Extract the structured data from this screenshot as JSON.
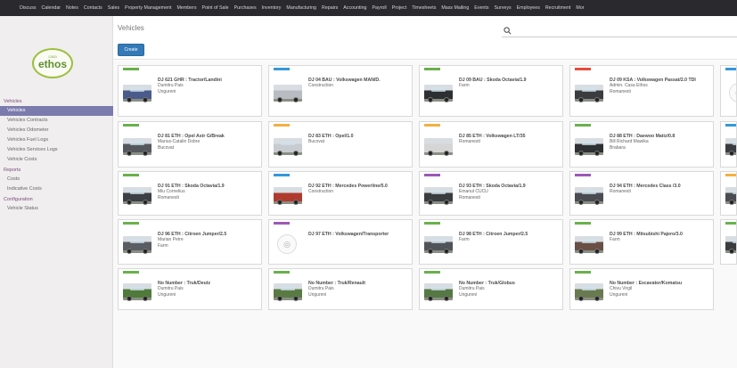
{
  "top_menu": [
    "Discuss",
    "Calendar",
    "Notes",
    "Contacts",
    "Sales",
    "Property Management",
    "Members",
    "Point of Sale",
    "Purchases",
    "Inventory",
    "Manufacturing",
    "Repairs",
    "Accounting",
    "Payroll",
    "Project",
    "Timesheets",
    "Mass Mailing",
    "Events",
    "Surveys",
    "Employees",
    "Recruitment",
    "Mor"
  ],
  "logo": {
    "small": "casa",
    "big": "ethos"
  },
  "sidebar": {
    "sections": [
      {
        "heading": "Vehicles",
        "items": [
          {
            "label": "Vehicles",
            "active": true
          },
          {
            "label": "Vehicles Contracts",
            "active": false
          },
          {
            "label": "Vehicles Odometer",
            "active": false
          },
          {
            "label": "Vehicles Fuel Logs",
            "active": false
          },
          {
            "label": "Vehicles Services Logs",
            "active": false
          },
          {
            "label": "Vehicle Costs",
            "active": false
          }
        ]
      },
      {
        "heading": "Reports",
        "items": [
          {
            "label": "Costs",
            "active": false
          },
          {
            "label": "Indicative Costs",
            "active": false
          }
        ]
      },
      {
        "heading": "Configuration",
        "items": [
          {
            "label": "Vehicle Status",
            "active": false
          }
        ]
      }
    ]
  },
  "header": {
    "breadcrumb": "Vehicles",
    "create_label": "Create",
    "search_placeholder": ""
  },
  "colors": {
    "accent": "#7c7bad",
    "button": "#337ab7"
  },
  "cards": [
    {
      "title": "DJ 621 GHR : Tractor/Landini",
      "lines": [
        "Dumitru Pais",
        "Ungureni"
      ],
      "tag": "#6ab04c",
      "photo": "tractor",
      "body": "#4a5a8a"
    },
    {
      "title": "DJ 04 BAU : Volkswagen MAN/D.",
      "lines": [
        "Construction"
      ],
      "tag": "#3498db",
      "photo": "truck",
      "body": "#b8bcc2"
    },
    {
      "title": "DJ 09 BAU : Skoda Octavia/1.9",
      "lines": [
        "Farm"
      ],
      "tag": "#6ab04c",
      "photo": "car",
      "body": "#2d2f33"
    },
    {
      "title": "DJ 09 KSA : Volkswagen Passat/2.0 TDI",
      "lines": [
        "Admin. Casa Ethos",
        "Romanesti"
      ],
      "tag": "#e74c3c",
      "photo": "car",
      "body": "#3a3c40"
    },
    {
      "title": "DJ 81 ETH : Opel Astr G/Break",
      "lines": [
        "Marius-Catalin Dobre",
        "Bucovat"
      ],
      "tag": "#6ab04c",
      "photo": "car",
      "body": "#55585e"
    },
    {
      "title": "DJ 83 ETH : Opel/1.0",
      "lines": [
        "Bucovat"
      ],
      "tag": "#f5b041",
      "photo": "car",
      "body": "#c8cbd0"
    },
    {
      "title": "DJ 85 ETH : Volkswagen LT/35",
      "lines": [
        "Romanesti"
      ],
      "tag": "#f5b041",
      "photo": "truck",
      "body": "#d5d5d5"
    },
    {
      "title": "DJ 88 ETH : Daewoo Matiz/0.8",
      "lines": [
        "Bill Richard Mawika",
        "Brabara"
      ],
      "tag": "#6ab04c",
      "photo": "car",
      "body": "#2e3034"
    },
    {
      "title": "DJ 91 ETH : Skoda Octavia/1.9",
      "lines": [
        "Miu Cornelius",
        "Romanesti"
      ],
      "tag": "#6ab04c",
      "photo": "car",
      "body": "#3c3f44"
    },
    {
      "title": "DJ 92 ETH : Mercedes Powerline/5.0",
      "lines": [
        "Construction"
      ],
      "tag": "#3498db",
      "photo": "truck",
      "body": "#b03a2e"
    },
    {
      "title": "DJ 93 ETH : Skoda Octavia/1.9",
      "lines": [
        "Emanul CUCU",
        "Romanesti"
      ],
      "tag": "#9b59b6",
      "photo": "car",
      "body": "#3a3c40"
    },
    {
      "title": "DJ 94 ETH : Mercedes Class /3.0",
      "lines": [
        "Romanesti"
      ],
      "tag": "#9b59b6",
      "photo": "car",
      "body": "#4a4c52"
    },
    {
      "title": "DJ 96 ETH : Citroen Jumper/2.5",
      "lines": [
        "Marian Petre",
        "Farm"
      ],
      "tag": "#6ab04c",
      "photo": "car",
      "body": "#5a5d63"
    },
    {
      "title": "DJ 97 ETH : Volkswagen/Transporter",
      "lines": [],
      "tag": "#9b59b6",
      "photo": "none",
      "body": ""
    },
    {
      "title": "DJ 98 ETH : Citroen Jumper/2.5",
      "lines": [
        "Farm"
      ],
      "tag": "#6ab04c",
      "photo": "car",
      "body": "#505358"
    },
    {
      "title": "DJ 99 ETH : Mitsubishi Pajero/3.0",
      "lines": [
        "Farm"
      ],
      "tag": "#6ab04c",
      "photo": "car",
      "body": "#6a4f45"
    },
    {
      "title": "No Number : Truk/Deutz",
      "lines": [
        "Dumitru Pais",
        "Ungureni"
      ],
      "tag": "#6ab04c",
      "photo": "tractor",
      "body": "#4f7a3a"
    },
    {
      "title": "No Number : Truk/Renault",
      "lines": [
        "Dumitru Pais",
        "Ungureni"
      ],
      "tag": "#6ab04c",
      "photo": "tractor",
      "body": "#5a7a44"
    },
    {
      "title": "No Number : Truk/Globus",
      "lines": [
        "Dumitru Pais",
        "Ungureni"
      ],
      "tag": "#6ab04c",
      "photo": "tractor",
      "body": "#567845"
    },
    {
      "title": "No Number : Excavator/Komatsu",
      "lines": [
        "Chivu Virgil",
        "Ungureni"
      ],
      "tag": "#6ab04c",
      "photo": "tractor",
      "body": "#6a7a50"
    }
  ],
  "partial_cards": [
    {
      "tag": "#3498db",
      "photo": "none",
      "body": ""
    },
    {
      "tag": "#3498db",
      "photo": "car",
      "body": "#3a3c40"
    },
    {
      "tag": "#f5b041",
      "photo": "car",
      "body": "#4a4c52"
    },
    {
      "tag": "#6ab04c",
      "photo": "car",
      "body": "#3a3c40"
    }
  ]
}
